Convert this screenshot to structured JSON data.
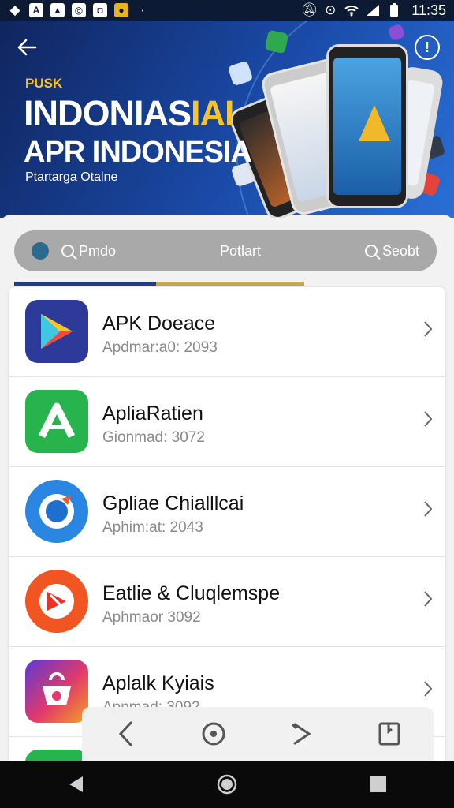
{
  "status_bar": {
    "time": "11:35",
    "left_icons": [
      "diamond-icon",
      "a-app-icon",
      "photo-app-icon",
      "sync-app-icon",
      "camera-app-icon",
      "yellow-app-icon",
      "dot-icon"
    ],
    "right_icons": [
      "mute-icon",
      "location-icon",
      "wifi-icon",
      "signal-icon",
      "battery-icon"
    ]
  },
  "hero": {
    "brand": "PUSK",
    "title_main": "INDONIAS",
    "title_accent": "IAI",
    "subtitle": "APR INDONESIA",
    "caption": "Ptartarga Otalne",
    "info_label": "!"
  },
  "segmented_control": {
    "left_label": "Pmdo",
    "middle_label": "Potlart",
    "right_label": "Seobt"
  },
  "apps": [
    {
      "title": "APK Doeace",
      "subtitle": "Apdmar:a0: 2093",
      "icon": "play-store-icon",
      "color": "#2d3a9a"
    },
    {
      "title": "ApliaRatien",
      "subtitle": "Gionmad: 3072",
      "icon": "green-a-app-icon",
      "color": "#27b44d"
    },
    {
      "title": "Gpliae Chialllcai",
      "subtitle": "Aphim:at: 2043",
      "icon": "blue-ring-app-icon",
      "color": "#2a86e0"
    },
    {
      "title": "Eatlie & Cluqlemspe",
      "subtitle": "Aphmaor 3092",
      "icon": "red-play-app-icon",
      "color": "#f05522"
    },
    {
      "title": "Aplalk Kyiais",
      "subtitle": "Apnmad: 3092",
      "icon": "gradient-bag-app-icon",
      "color": "#d83a6a"
    }
  ],
  "float_bar": {
    "buttons": [
      "back-icon",
      "stop-icon",
      "forward-icon",
      "bookmark-icon"
    ]
  },
  "colors": {
    "hero_bg": "#1a4aa8",
    "accent_yellow": "#f4c430",
    "segment_bg": "#a9a9a9",
    "progress_blue": "#1f3d8a",
    "progress_gold": "#c9a54a"
  }
}
